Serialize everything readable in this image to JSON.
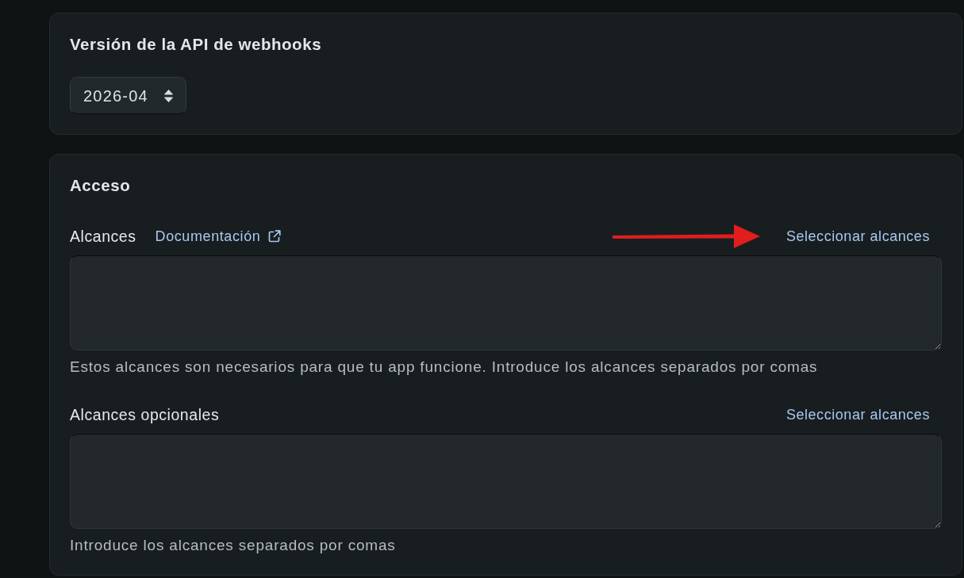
{
  "webhook_api_version": {
    "title": "Versión de la API de webhooks",
    "select": {
      "value": "2026-04"
    }
  },
  "access": {
    "title": "Acceso",
    "fields": [
      {
        "label": "Alcances",
        "doc_link": "Documentación",
        "action": "Seleccionar alcances",
        "arrow": true,
        "help": "Estos alcances son necesarios para que tu app funcione. Introduce los alcances separados por comas"
      },
      {
        "label": "Alcances opcionales",
        "action": "Seleccionar alcances",
        "arrow": false,
        "help": "Introduce los alcances separados por comas"
      }
    ]
  }
}
